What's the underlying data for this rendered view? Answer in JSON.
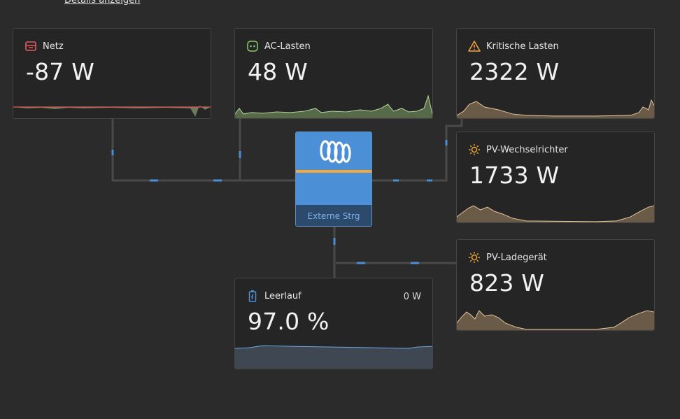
{
  "header": {
    "details_link": "Details anzeigen"
  },
  "inverter": {
    "label": "Externe Strg"
  },
  "cards": {
    "grid": {
      "title": "Netz",
      "value": "-87 W",
      "icon": "grid-icon",
      "color": "#e25b5b"
    },
    "ac_loads": {
      "title": "AC-Lasten",
      "value": "48 W",
      "icon": "socket-icon",
      "color": "#8bc46a"
    },
    "critical_loads": {
      "title": "Kritische Lasten",
      "value": "2322 W",
      "icon": "warning-icon",
      "color": "#f3a73b"
    },
    "pv_inverter": {
      "title": "PV-Wechselrichter",
      "value": "1733 W",
      "icon": "sun-icon",
      "color": "#f3a73b"
    },
    "pv_charger": {
      "title": "PV-Ladegerät",
      "value": "823 W",
      "icon": "sun-icon",
      "color": "#f3a73b"
    },
    "battery": {
      "title": "Leerlauf",
      "value": "97.0 %",
      "power": "0 W",
      "icon": "battery-icon",
      "color": "#4b8fd6"
    }
  }
}
